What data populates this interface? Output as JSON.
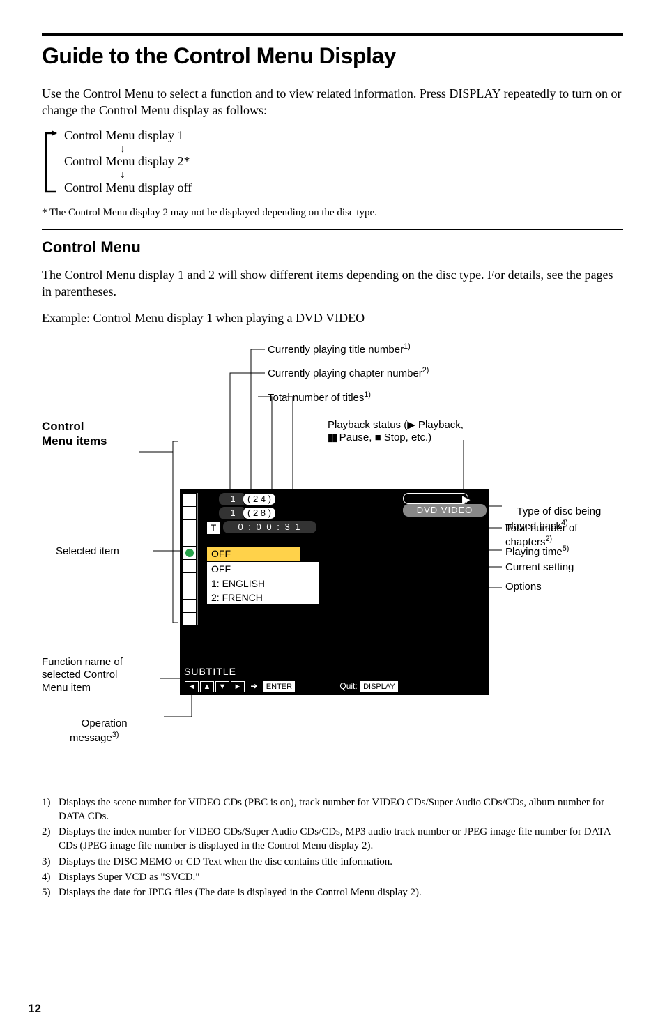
{
  "header": {
    "title": "Guide to the Control Menu Display",
    "intro": "Use the Control Menu to select a function and to view related information. Press DISPLAY repeatedly to turn on or change the Control Menu display as follows:"
  },
  "flow": {
    "step1": "Control Menu display 1",
    "step2": "Control Menu display 2*",
    "step3": "Control Menu display off"
  },
  "footnote_star": "* The Control Menu display 2 may not be displayed depending on the disc type.",
  "section": {
    "heading": "Control Menu",
    "para1": "The Control Menu display 1 and 2 will show different items depending on the disc type. For details, see the pages in parentheses.",
    "para2": "Example: Control Menu display 1 when playing a DVD VIDEO"
  },
  "figure": {
    "labels": {
      "control_menu_items": "Control\nMenu items",
      "selected_item": "Selected item",
      "function_name": "Function name of\nselected Control\nMenu item",
      "operation_msg": "Operation\nmessage",
      "cur_title": "Currently playing title number",
      "cur_chapter": "Currently playing chapter number",
      "total_titles": "Total number of titles",
      "playback_status_pre": "Playback status (",
      "playback_status_play": " Playback,",
      "playback_status_pause": " Pause, ",
      "playback_status_stop": " Stop, etc.)",
      "type_disc": "Type of disc being\nplayed back",
      "total_chapters": "Total number of chapters",
      "playing_time": "Playing time",
      "current_setting": "Current setting",
      "options": "Options",
      "sup1": "1)",
      "sup2": "2)",
      "sup3": "3)",
      "sup4": "4)",
      "sup5": "5)"
    },
    "osd": {
      "title_num_total": "( 2 4 )",
      "chapter_num_total": "( 2 8 )",
      "title_cur": "1",
      "chapter_cur": "1",
      "time_prefix": "T",
      "time": "0 : 0 0 : 3 1",
      "disc_type": "DVD VIDEO",
      "line_off1": "OFF",
      "line_off2": "OFF",
      "line_lang1": "1: ENGLISH",
      "line_lang2": "2: FRENCH",
      "subtitle": "SUBTITLE",
      "enter": "ENTER",
      "quit": "Quit:",
      "display": "DISPLAY"
    }
  },
  "footnotes": {
    "n1": "Displays the scene number for VIDEO CDs (PBC is on), track number for VIDEO CDs/Super Audio CDs/CDs, album number for DATA CDs.",
    "n2": "Displays the index number for VIDEO CDs/Super Audio CDs/CDs, MP3 audio track number or JPEG image file number for DATA CDs (JPEG image file number is displayed in the Control Menu display 2).",
    "n3": "Displays the DISC MEMO or CD Text when the disc contains title information.",
    "n4": "Displays Super VCD as \"SVCD.\"",
    "n5": "Displays the date for JPEG files (The date is displayed in the Control Menu display 2)."
  },
  "page_number": "12"
}
